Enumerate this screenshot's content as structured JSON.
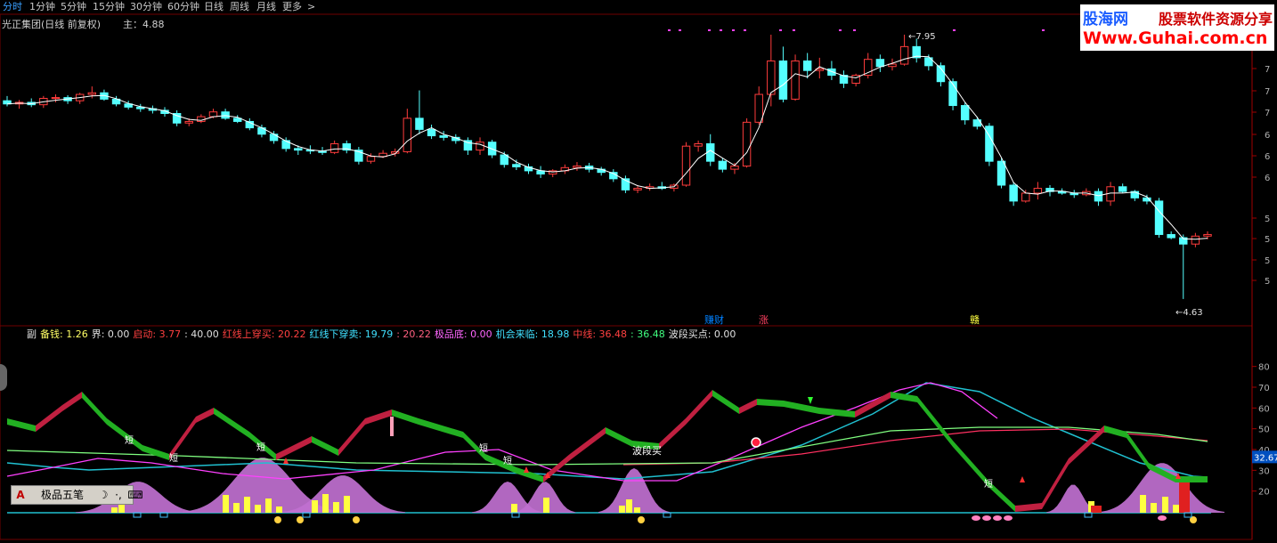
{
  "toolbar": {
    "periods": [
      "分时",
      "1分钟",
      "5分钟",
      "15分钟",
      "30分钟",
      "60分钟",
      "日线",
      "周线",
      "月线",
      "更多",
      ">"
    ],
    "active_index": 0
  },
  "header": {
    "stock_name": "光正集团(日线 前复权)",
    "main_label": "主：4.88"
  },
  "watermark": {
    "brand": "股海网",
    "slogan": "股票软件资源分享",
    "url": "Www.Guhai.com.cn"
  },
  "annotations": {
    "high_label": "7.95",
    "low_label": "4.63",
    "signal_labels": [
      "赚财",
      "涨",
      "赣"
    ],
    "short_labels": [
      "短",
      "短",
      "短",
      "短",
      "短",
      "短"
    ],
    "wave_buy": "波段买"
  },
  "sub_indicator": {
    "items": [
      {
        "text": "副",
        "color": "#e0e0e0"
      },
      {
        "text": "备钱: 1.26",
        "color": "#ffff66"
      },
      {
        "text": "界: 0.00",
        "color": "#e0e0e0"
      },
      {
        "text": "启动: 3.77",
        "color": "#ff4040"
      },
      {
        "text": ": 40.00",
        "color": "#e0e0e0"
      },
      {
        "text": "红线上穿买: 20.22",
        "color": "#ff4040"
      },
      {
        "text": "红线下穿卖: 19.79",
        "color": "#40e0ff"
      },
      {
        "text": ": 20.22",
        "color": "#ff6080"
      },
      {
        "text": "极品底: 0.00",
        "color": "#ff66ff"
      },
      {
        "text": "机会来临: 18.98",
        "color": "#40e0ff"
      },
      {
        "text": "中线: 36.48",
        "color": "#ff4040"
      },
      {
        "text": ": 36.48",
        "color": "#40ff80"
      },
      {
        "text": "波段买点: 0.00",
        "color": "#e0e0e0"
      }
    ],
    "right_value": "32.67",
    "axis_ticks": [
      "80",
      "70",
      "60",
      "50",
      "40",
      "30",
      "20"
    ]
  },
  "toolbox": {
    "items": [
      "A",
      "极品五笔",
      "☽",
      "·,",
      "⌨"
    ]
  },
  "colors": {
    "up": "#ff3c3c",
    "down": "#54ffff",
    "ma": "#ffffff",
    "green_band": "#22b022",
    "red_band": "#c02040",
    "mountain": "#c070d0",
    "yellow_bar": "#ffff40",
    "cyan_line": "#20c0d0",
    "magenta_line": "#ff40ff",
    "green_line": "#80ff80",
    "grid": "#3a0000"
  },
  "chart_data": {
    "type": "candlestick",
    "price_axis_ticks": [
      "7",
      "7",
      "7",
      "6",
      "6",
      "6",
      "5",
      "5",
      "5",
      "5"
    ],
    "ohlc": [
      [
        7.12,
        7.18,
        7.05,
        7.08
      ],
      [
        7.08,
        7.13,
        7.02,
        7.1
      ],
      [
        7.1,
        7.15,
        7.04,
        7.07
      ],
      [
        7.07,
        7.18,
        7.03,
        7.15
      ],
      [
        7.15,
        7.2,
        7.1,
        7.16
      ],
      [
        7.16,
        7.19,
        7.08,
        7.12
      ],
      [
        7.12,
        7.22,
        7.08,
        7.2
      ],
      [
        7.2,
        7.3,
        7.15,
        7.22
      ],
      [
        7.22,
        7.26,
        7.12,
        7.14
      ],
      [
        7.14,
        7.18,
        7.05,
        7.08
      ],
      [
        7.08,
        7.12,
        7.01,
        7.04
      ],
      [
        7.04,
        7.08,
        6.98,
        7.02
      ],
      [
        7.02,
        7.06,
        6.96,
        7.0
      ],
      [
        7.0,
        7.04,
        6.92,
        6.96
      ],
      [
        6.96,
        7.0,
        6.8,
        6.84
      ],
      [
        6.84,
        6.9,
        6.8,
        6.86
      ],
      [
        6.86,
        6.95,
        6.84,
        6.92
      ],
      [
        6.92,
        7.02,
        6.9,
        6.98
      ],
      [
        6.98,
        7.02,
        6.88,
        6.9
      ],
      [
        6.9,
        6.94,
        6.84,
        6.86
      ],
      [
        6.86,
        6.9,
        6.75,
        6.78
      ],
      [
        6.78,
        6.82,
        6.66,
        6.7
      ],
      [
        6.7,
        6.74,
        6.58,
        6.62
      ],
      [
        6.62,
        6.66,
        6.48,
        6.52
      ],
      [
        6.52,
        6.56,
        6.44,
        6.5
      ],
      [
        6.5,
        6.56,
        6.45,
        6.49
      ],
      [
        6.49,
        6.54,
        6.44,
        6.47
      ],
      [
        6.47,
        6.62,
        6.45,
        6.58
      ],
      [
        6.58,
        6.62,
        6.46,
        6.5
      ],
      [
        6.5,
        6.54,
        6.32,
        6.36
      ],
      [
        6.36,
        6.46,
        6.33,
        6.42
      ],
      [
        6.42,
        6.5,
        6.4,
        6.46
      ],
      [
        6.46,
        6.52,
        6.42,
        6.48
      ],
      [
        6.48,
        7.02,
        6.46,
        6.9
      ],
      [
        6.9,
        7.25,
        6.7,
        6.76
      ],
      [
        6.76,
        6.82,
        6.64,
        6.68
      ],
      [
        6.68,
        6.74,
        6.62,
        6.66
      ],
      [
        6.66,
        6.7,
        6.58,
        6.62
      ],
      [
        6.62,
        6.66,
        6.44,
        6.5
      ],
      [
        6.5,
        6.66,
        6.44,
        6.6
      ],
      [
        6.6,
        6.63,
        6.4,
        6.44
      ],
      [
        6.44,
        6.48,
        6.28,
        6.32
      ],
      [
        6.32,
        6.38,
        6.25,
        6.29
      ],
      [
        6.29,
        6.33,
        6.2,
        6.24
      ],
      [
        6.24,
        6.3,
        6.15,
        6.2
      ],
      [
        6.2,
        6.26,
        6.16,
        6.24
      ],
      [
        6.24,
        6.32,
        6.2,
        6.28
      ],
      [
        6.28,
        6.35,
        6.24,
        6.3
      ],
      [
        6.3,
        6.34,
        6.22,
        6.26
      ],
      [
        6.26,
        6.29,
        6.18,
        6.22
      ],
      [
        6.22,
        6.26,
        6.1,
        6.14
      ],
      [
        6.14,
        6.18,
        5.96,
        6.0
      ],
      [
        6.0,
        6.06,
        5.96,
        6.02
      ],
      [
        6.02,
        6.08,
        5.99,
        6.04
      ],
      [
        6.04,
        6.1,
        6.0,
        6.02
      ],
      [
        6.02,
        6.08,
        5.98,
        6.06
      ],
      [
        6.06,
        6.6,
        6.04,
        6.55
      ],
      [
        6.55,
        6.62,
        6.48,
        6.58
      ],
      [
        6.58,
        6.7,
        6.3,
        6.36
      ],
      [
        6.36,
        6.4,
        6.22,
        6.26
      ],
      [
        6.26,
        6.34,
        6.2,
        6.3
      ],
      [
        6.3,
        6.9,
        6.28,
        6.85
      ],
      [
        6.85,
        7.3,
        6.82,
        7.2
      ],
      [
        7.2,
        7.95,
        7.05,
        7.62
      ],
      [
        7.62,
        7.8,
        7.1,
        7.14
      ],
      [
        7.14,
        7.7,
        7.12,
        7.62
      ],
      [
        7.62,
        7.72,
        7.4,
        7.5
      ],
      [
        7.5,
        7.66,
        7.4,
        7.52
      ],
      [
        7.52,
        7.62,
        7.38,
        7.44
      ],
      [
        7.44,
        7.5,
        7.28,
        7.34
      ],
      [
        7.34,
        7.46,
        7.3,
        7.44
      ],
      [
        7.44,
        7.72,
        7.4,
        7.64
      ],
      [
        7.64,
        7.7,
        7.48,
        7.55
      ],
      [
        7.55,
        7.65,
        7.5,
        7.58
      ],
      [
        7.58,
        7.95,
        7.56,
        7.8
      ],
      [
        7.8,
        7.9,
        7.6,
        7.66
      ],
      [
        7.66,
        7.7,
        7.5,
        7.56
      ],
      [
        7.56,
        7.6,
        7.3,
        7.36
      ],
      [
        7.36,
        7.4,
        7.0,
        7.06
      ],
      [
        7.06,
        7.1,
        6.82,
        6.88
      ],
      [
        6.88,
        6.92,
        6.76,
        6.8
      ],
      [
        6.8,
        6.84,
        6.3,
        6.36
      ],
      [
        6.36,
        6.4,
        6.02,
        6.06
      ],
      [
        6.06,
        6.1,
        5.8,
        5.86
      ],
      [
        5.86,
        6.0,
        5.84,
        5.96
      ],
      [
        5.96,
        6.1,
        5.88,
        6.02
      ],
      [
        6.02,
        6.06,
        5.92,
        5.98
      ],
      [
        5.98,
        6.02,
        5.94,
        5.96
      ],
      [
        5.96,
        6.0,
        5.9,
        5.94
      ],
      [
        5.94,
        6.02,
        5.92,
        5.98
      ],
      [
        5.98,
        6.02,
        5.8,
        5.86
      ],
      [
        5.86,
        6.1,
        5.8,
        6.04
      ],
      [
        6.04,
        6.08,
        5.96,
        5.98
      ],
      [
        5.98,
        6.0,
        5.86,
        5.9
      ],
      [
        5.9,
        5.94,
        5.82,
        5.86
      ],
      [
        5.86,
        5.9,
        5.4,
        5.44
      ],
      [
        5.44,
        5.48,
        5.38,
        5.4
      ],
      [
        5.4,
        5.44,
        4.63,
        5.32
      ],
      [
        5.32,
        5.46,
        5.28,
        5.42
      ],
      [
        5.42,
        5.48,
        5.38,
        5.44
      ]
    ]
  }
}
